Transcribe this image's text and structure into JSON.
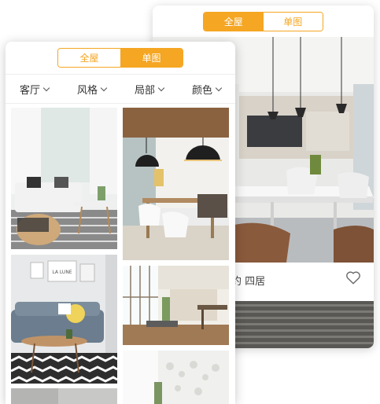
{
  "back_screen": {
    "toggle": {
      "options": [
        "全屋",
        "单图"
      ],
      "active_index": 0
    },
    "caption": "约 四居",
    "favorite_icon": "heart-outline-icon"
  },
  "front_screen": {
    "toggle": {
      "options": [
        "全屋",
        "单图"
      ],
      "active_index": 1
    },
    "filters": [
      {
        "label": "客厅",
        "icon": "chevron-down-icon"
      },
      {
        "label": "风格",
        "icon": "chevron-down-icon"
      },
      {
        "label": "局部",
        "icon": "chevron-down-icon"
      },
      {
        "label": "颜色",
        "icon": "chevron-down-icon"
      }
    ],
    "poster_text": "LA LUNE"
  },
  "colors": {
    "accent": "#f5a623",
    "text": "#333333",
    "border": "#eeeeee"
  }
}
